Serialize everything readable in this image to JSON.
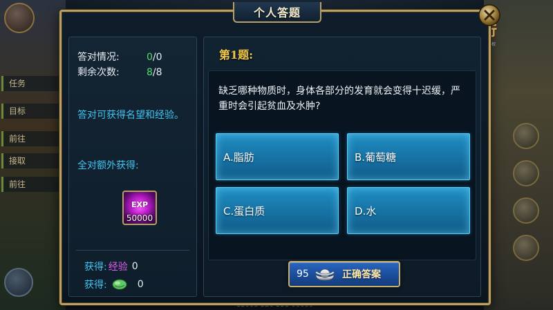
{
  "dialog": {
    "title": "个人答题"
  },
  "left": {
    "correct_label": "答对情况:",
    "correct_num": "0",
    "correct_total": "/0",
    "remaining_label": "剩余次数:",
    "remaining_num": "8",
    "remaining_total": "/8",
    "info_text": "答对可获得名望和经验。",
    "bonus_label": "全对额外获得:",
    "exp_item": {
      "label": "EXP",
      "count": "50000",
      "icon": "exp-orb-icon"
    },
    "reward_exp": {
      "prefix": "获得:",
      "name": "经验",
      "value": "0"
    },
    "reward_jade": {
      "prefix": "获得:",
      "icon": "green-jade-icon",
      "value": "0"
    }
  },
  "question": {
    "number_label": "第1题:",
    "text": "缺乏哪种物质时，身体各部分的发育就会变得十迟缓，严重时会引起贫血及水肿?",
    "options": [
      {
        "label": "A.脂肪"
      },
      {
        "label": "B.葡萄糖"
      },
      {
        "label": "C.蛋白质"
      },
      {
        "label": "D.水"
      }
    ],
    "answer_button": {
      "cost": "95",
      "icon": "silver-ingot-icon",
      "label": "正确答案"
    }
  },
  "background": {
    "logo_title": "龍行",
    "logo_sub": "华夏游戏授权",
    "bottom_strip_text": "13008 320 558 00000",
    "quest_rows": [
      "任务",
      "目标",
      "前往",
      "接取",
      "前往"
    ]
  },
  "colors": {
    "frame_gold": "#b8a068",
    "cyan_text": "#3ec6f2",
    "green_value": "#4fe06a",
    "question_yellow": "#f2c84a",
    "answer_blue": "#1876a8",
    "purple_exp": "#e05cf0"
  }
}
